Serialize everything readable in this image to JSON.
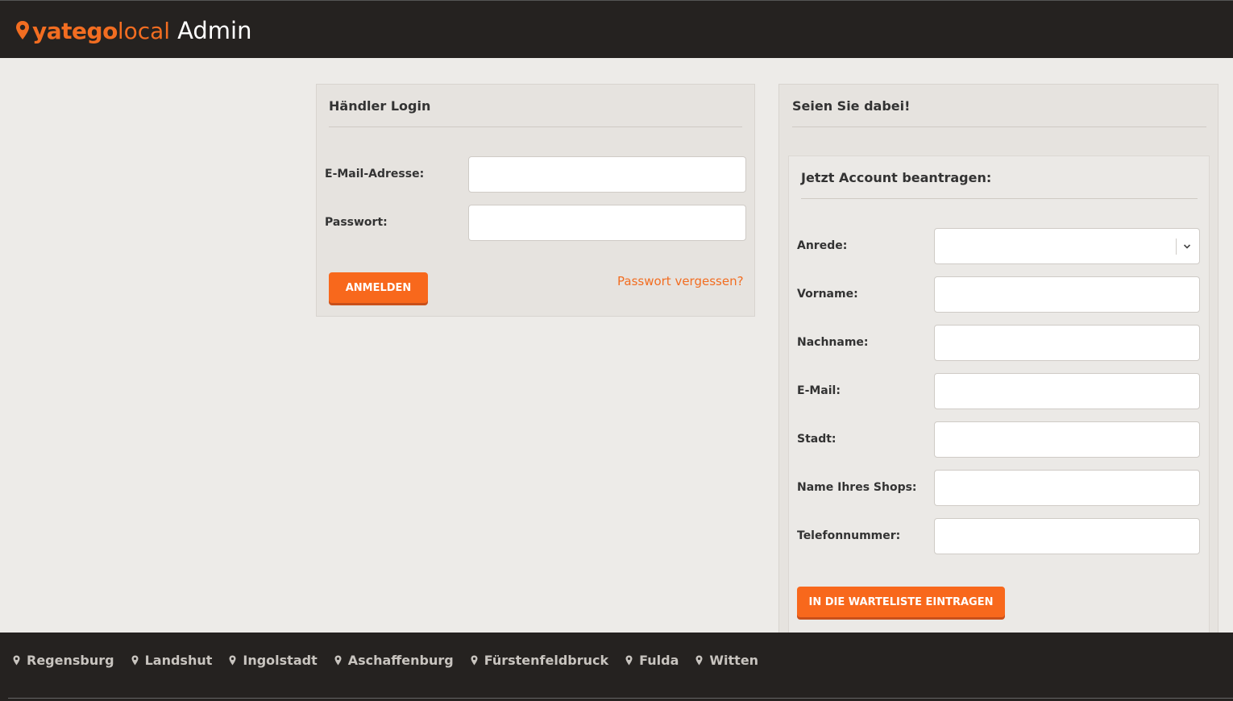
{
  "header": {
    "brand": "yatego",
    "brand_suffix": "local",
    "admin_label": "Admin"
  },
  "login": {
    "title": "Händler Login",
    "email_label": "E-Mail-Adresse:",
    "email_value": "",
    "password_label": "Passwort:",
    "password_value": "",
    "submit_label": "ANMELDEN",
    "forgot_label": "Passwort vergessen?"
  },
  "signup": {
    "title": "Seien Sie dabei!",
    "subtitle": "Jetzt Account beantragen:",
    "fields": {
      "anrede": "Anrede:",
      "vorname": "Vorname:",
      "nachname": "Nachname:",
      "email": "E-Mail:",
      "stadt": "Stadt:",
      "shop": "Name Ihres Shops:",
      "telefon": "Telefonnummer:"
    },
    "submit_label": "IN DIE WARTELISTE EINTRAGEN"
  },
  "footer": {
    "cities": [
      "Regensburg",
      "Landshut",
      "Ingolstadt",
      "Aschaffenburg",
      "Fürstenfeldbruck",
      "Fulda",
      "Witten"
    ]
  },
  "colors": {
    "accent": "#f8681c",
    "header_bg": "#252220",
    "page_bg": "#edebe8",
    "panel_bg": "#e6e3df"
  }
}
